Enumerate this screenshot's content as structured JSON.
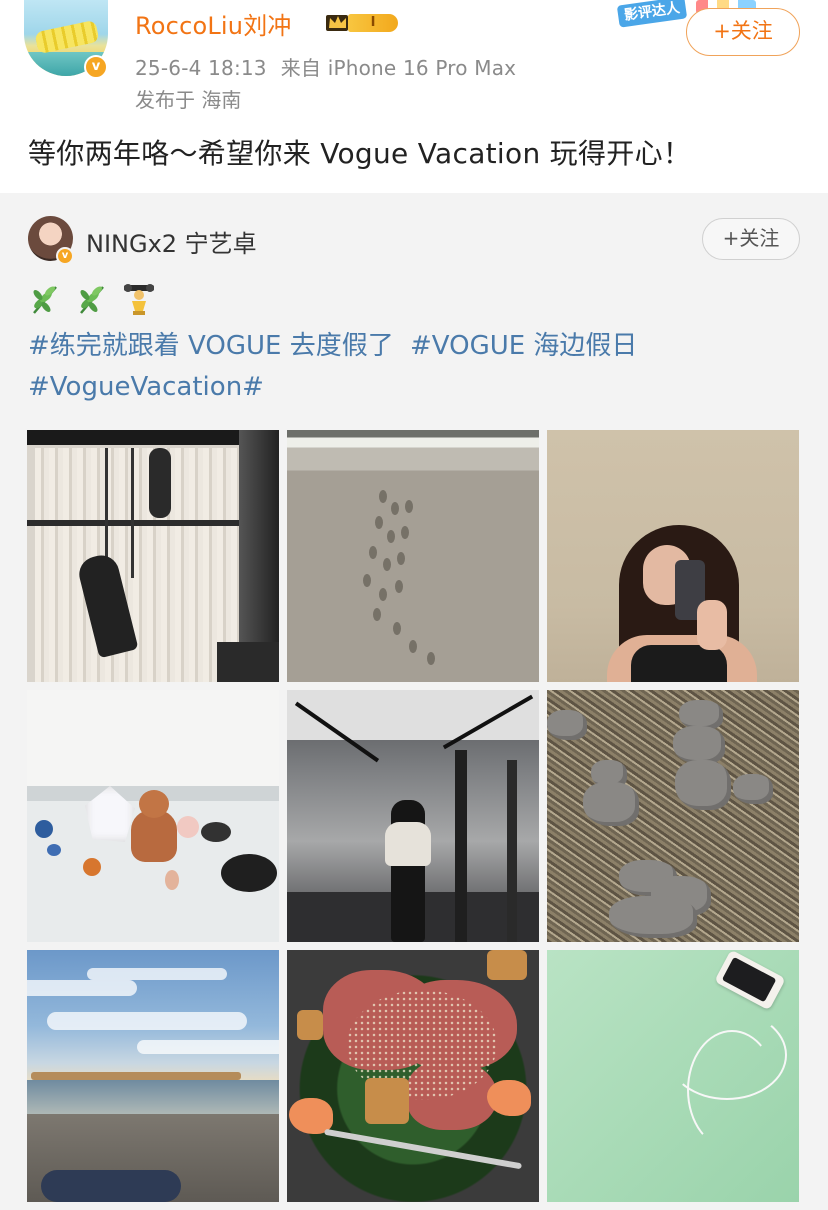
{
  "main_post": {
    "username": "RoccoLiu刘冲",
    "level_label": "I",
    "timestamp": "25-6-4 18:13",
    "source": "来自 iPhone 16 Pro Max",
    "location": "发布于 海南",
    "tag_badge": "影评达人",
    "follow_label": "+关注",
    "text": "等你两年咯～希望你来 Vogue Vacation 玩得开心！"
  },
  "repost": {
    "username": "NINGx2 宁艺卓",
    "follow_label": "+关注",
    "emojis": [
      "herb-icon",
      "herb-icon",
      "trophy-icon"
    ],
    "hashtags": [
      "#练完就跟着 VOGUE 去度假了",
      "#VOGUE 海边假日",
      "#VogueVacation#"
    ],
    "photos": [
      "aerial-yoga-photo",
      "beach-footprints-photo",
      "mirror-selfie-photo",
      "crystals-cat-photo",
      "gym-mirror-photo",
      "stone-cairns-photo",
      "beach-sky-photo",
      "salad-photo",
      "green-mat-phone-photo"
    ]
  },
  "colors": {
    "username_orange": "#f27414",
    "link_blue": "#4a7aaa",
    "repost_bg": "#f3f3f3",
    "meta_gray": "#8a8a8a"
  }
}
